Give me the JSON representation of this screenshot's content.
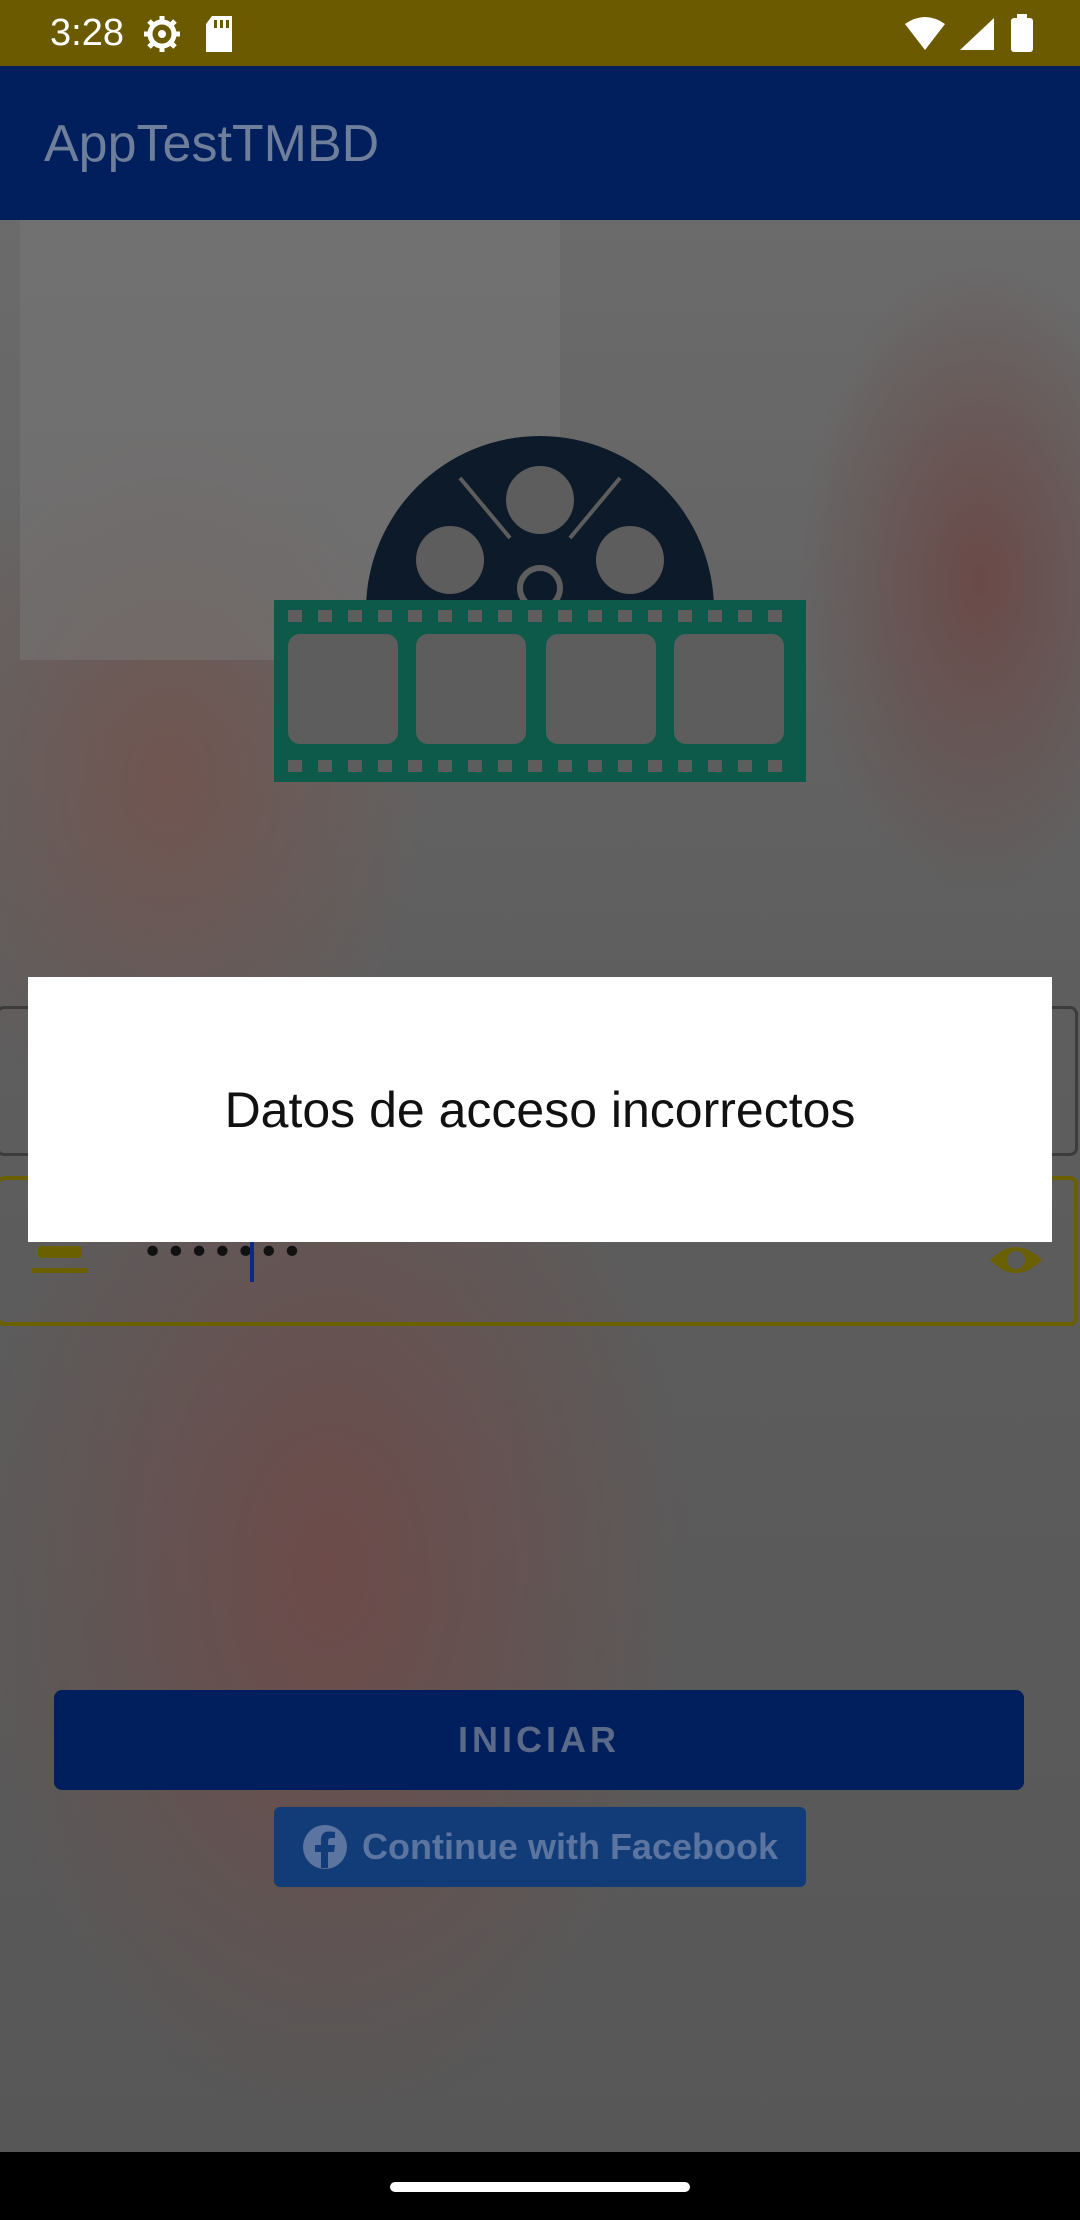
{
  "status_bar": {
    "time": "3:28",
    "icons_left": [
      "settings-gear-icon",
      "sd-card-icon"
    ],
    "icons_right": [
      "wifi-icon",
      "cell-signal-icon",
      "battery-icon"
    ],
    "background": "#6b5a00"
  },
  "app_bar": {
    "title": "AppTestTMBD",
    "background": "#001f5c"
  },
  "login": {
    "password_value": "•••••••",
    "login_button_label": "INICIAR",
    "facebook_button_label": "Continue with Facebook"
  },
  "dialog": {
    "message": "Datos de acceso incorrectos"
  },
  "colors": {
    "primary": "#001f5c",
    "film_green": "#0e5a4a",
    "reel_dark": "#0c1a2a",
    "password_border": "#6b6000"
  }
}
